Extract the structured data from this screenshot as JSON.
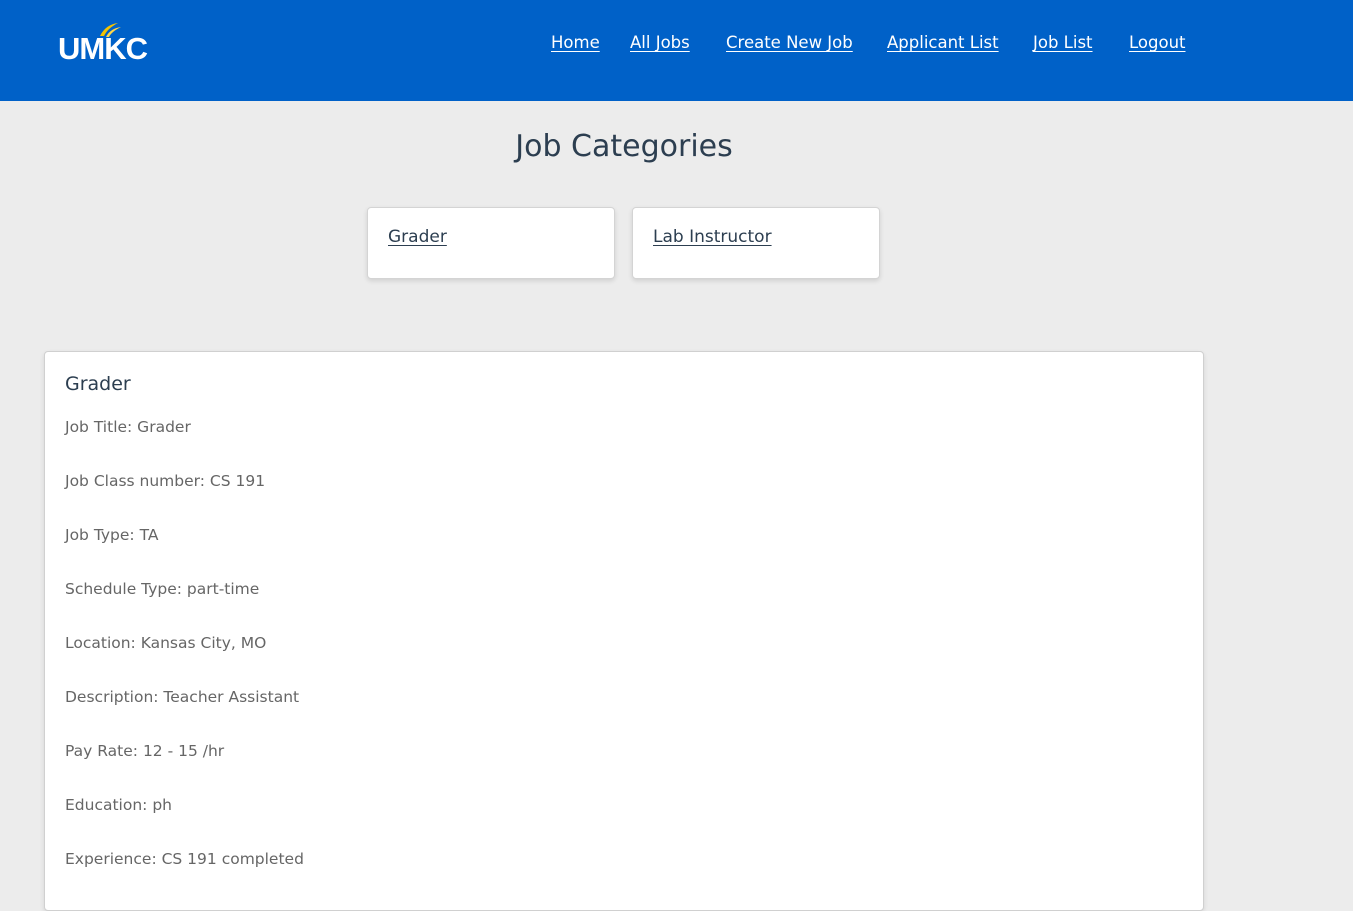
{
  "header": {
    "logo_text": "UMKC",
    "nav": [
      {
        "label": "Home"
      },
      {
        "label": "All Jobs"
      },
      {
        "label": "Create New Job"
      },
      {
        "label": "Applicant List"
      },
      {
        "label": "Job List"
      },
      {
        "label": "Logout"
      }
    ],
    "colors": {
      "background": "#0061c8",
      "flame": "#f5c400"
    }
  },
  "page": {
    "title": "Job Categories"
  },
  "categories": [
    {
      "label": "Grader"
    },
    {
      "label": "Lab Instructor"
    }
  ],
  "job_detail": {
    "title": "Grader",
    "fields": [
      "Job Title: Grader",
      "Job Class number: CS 191",
      "Job Type: TA",
      "Schedule Type: part-time",
      "Location: Kansas City, MO",
      "Description: Teacher Assistant",
      "Pay Rate: 12 - 15 /hr",
      "Education: ph",
      "Experience: CS 191 completed"
    ]
  }
}
